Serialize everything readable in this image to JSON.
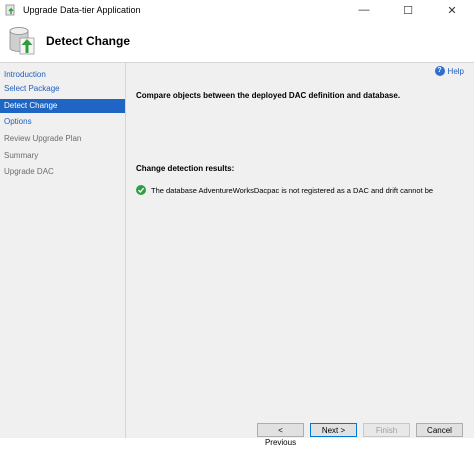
{
  "window": {
    "title": "Upgrade Data-tier Application",
    "controls": {
      "minimize": "—",
      "maximize": "☐",
      "close": "✕"
    }
  },
  "header": {
    "title": "Detect Change"
  },
  "sidebar": {
    "items": [
      {
        "label": "Introduction",
        "state": "link"
      },
      {
        "label": "Select Package",
        "state": "link"
      },
      {
        "label": "Detect Change",
        "state": "active"
      },
      {
        "label": "Options",
        "state": "link"
      },
      {
        "label": "Review Upgrade Plan",
        "state": "disabled"
      },
      {
        "label": "Summary",
        "state": "disabled"
      },
      {
        "label": "Upgrade DAC",
        "state": "disabled"
      }
    ]
  },
  "main": {
    "help_label": "Help",
    "description": "Compare objects between the deployed DAC definition and database.",
    "results_label": "Change detection results:",
    "result_message": "The database AdventureWorksDacpac is not registered as a DAC and drift cannot be"
  },
  "footer": {
    "previous": "< Previous",
    "next": "Next >",
    "finish": "Finish",
    "cancel": "Cancel"
  },
  "colors": {
    "accent": "#1f66c4",
    "link": "#1f5fbf",
    "success": "#2ea043",
    "panel": "#f0f0f0"
  },
  "icons": {
    "title": "database-upgrade-icon",
    "header": "database-upgrade-icon",
    "help": "help-icon",
    "result": "check-circle-icon"
  }
}
